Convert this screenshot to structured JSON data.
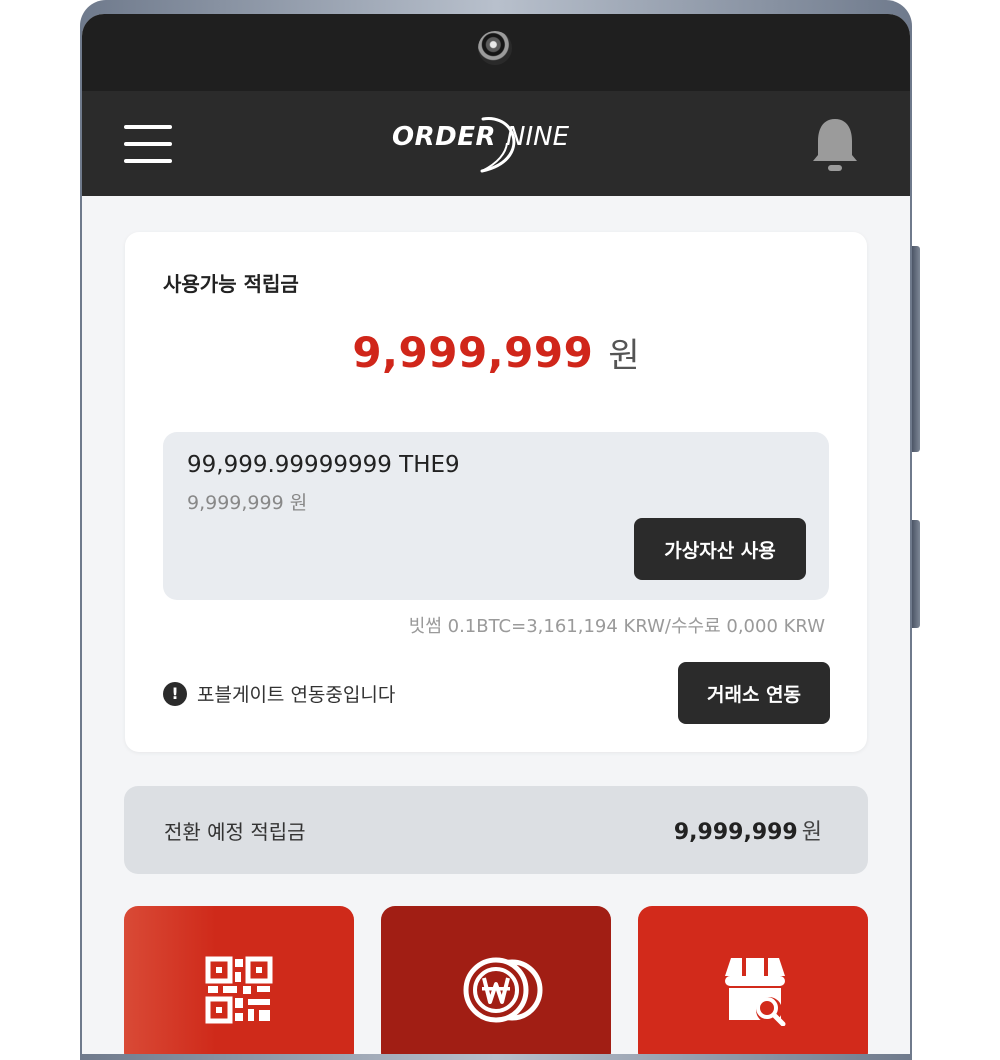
{
  "header": {
    "logo_order": "ORDER",
    "logo_nine": "NINE",
    "menu_icon": "hamburger-menu-icon",
    "bell_icon": "bell-icon"
  },
  "points_card": {
    "title": "사용가능 적립금",
    "amount": "9,999,999",
    "unit": "원",
    "asset": {
      "coin_amount": "99,999.99999999 THE9",
      "krw_amount": "9,999,999 원",
      "use_button": "가상자산 사용"
    },
    "rate_text": "빗썸 0.1BTC=3,161,194 KRW/수수료 0,000 KRW",
    "notice_icon_glyph": "!",
    "notice_text": "포블게이트 연동중입니다",
    "exchange_button": "거래소 연동"
  },
  "pending": {
    "label": "전환 예정 적립금",
    "amount": "9,999,999",
    "unit": "원"
  },
  "tiles": [
    {
      "icon": "qr-code-icon",
      "color": "#d0301f"
    },
    {
      "icon": "won-coin-icon",
      "color": "#a11e14"
    },
    {
      "icon": "store-search-icon",
      "color": "#d22a1b"
    }
  ],
  "colors": {
    "accent_red": "#d0261a",
    "dark": "#2b2b2b",
    "header_bg": "#2b2b2b",
    "screen_bg": "#f4f5f7"
  }
}
